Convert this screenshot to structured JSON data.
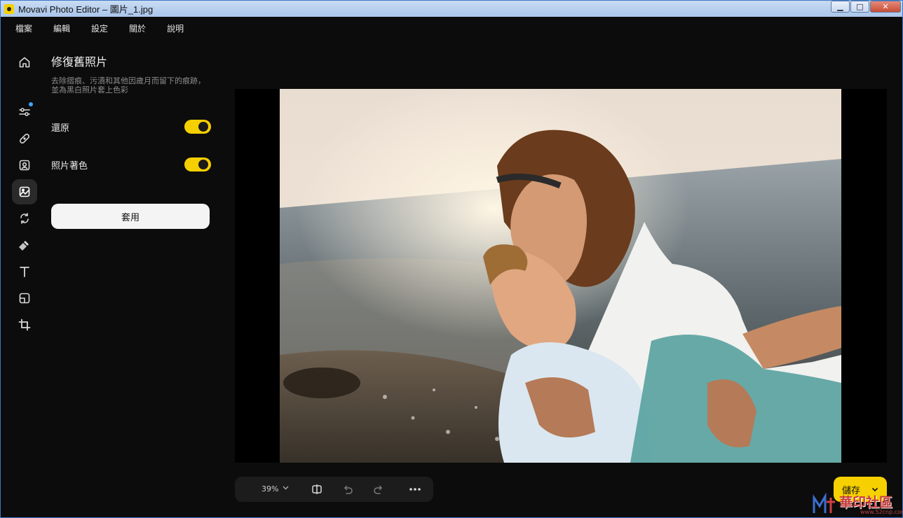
{
  "window": {
    "title": "Movavi Photo Editor – 圖片_1.jpg",
    "controls": {
      "minimize": "▁",
      "maximize": "□",
      "close": "✕"
    }
  },
  "menu": [
    "檔案",
    "編輯",
    "設定",
    "關於",
    "說明"
  ],
  "tool_rail": [
    {
      "name": "home-icon",
      "active": false
    },
    {
      "name": "adjust-sliders-icon",
      "active": false,
      "has_dot": true
    },
    {
      "name": "bandage-icon",
      "active": false
    },
    {
      "name": "portrait-icon",
      "active": false
    },
    {
      "name": "image-restore-icon",
      "active": true
    },
    {
      "name": "replace-background-icon",
      "active": false
    },
    {
      "name": "magic-wand-icon",
      "active": false
    },
    {
      "name": "text-icon",
      "active": false
    },
    {
      "name": "frame-icon",
      "active": false
    },
    {
      "name": "crop-icon",
      "active": false
    }
  ],
  "panel": {
    "title": "修復舊照片",
    "description": "去除摺痕、污漬和其他因歲月而留下的痕跡，並為黑白照片套上色彩",
    "options": [
      {
        "label": "還原",
        "enabled": true
      },
      {
        "label": "照片著色",
        "enabled": true
      }
    ],
    "apply_label": "套用"
  },
  "bottom_toolbar": {
    "zoom": "39%",
    "icons": [
      "compare-icon",
      "undo-icon",
      "redo-icon",
      "more-icon"
    ]
  },
  "save": {
    "label": "儲存"
  },
  "watermark": {
    "text": "華印社區",
    "url": "www.52cnp.com"
  },
  "colors": {
    "accent": "#f6d000",
    "background": "#0c0c0c",
    "dot": "#3fa4ff"
  }
}
